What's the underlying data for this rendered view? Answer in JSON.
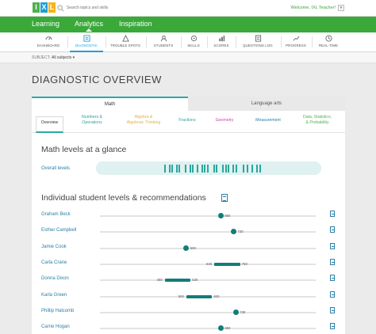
{
  "brand": {
    "logo_letters": [
      "I",
      "X",
      "L"
    ],
    "colors": {
      "green": "#3aa93a",
      "blue": "#1f9ed8",
      "teal": "#127d79",
      "yellow": "#f4b41a"
    }
  },
  "header": {
    "search_placeholder": "Search topics and skills",
    "welcome": "Welcome, IXL Teacher!",
    "dropdown_symbol": "▾"
  },
  "main_nav": [
    {
      "label": "Learning",
      "active": false
    },
    {
      "label": "Analytics",
      "active": true
    },
    {
      "label": "Inspiration",
      "active": false
    }
  ],
  "analytics_tabs": [
    {
      "label": "DASHBOARD",
      "icon": "gauge-icon",
      "active": false
    },
    {
      "label": "DIAGNOSTIC",
      "icon": "diagnostic-icon",
      "active": true
    },
    {
      "label": "TROUBLE SPOTS",
      "icon": "trouble-spots-icon",
      "active": false
    },
    {
      "label": "STUDENTS",
      "icon": "students-icon",
      "active": false
    },
    {
      "label": "SKILLS",
      "icon": "skills-icon",
      "active": false
    },
    {
      "label": "SCORES",
      "icon": "scores-icon",
      "active": false
    },
    {
      "label": "QUESTIONS LOG",
      "icon": "questions-log-icon",
      "active": false
    },
    {
      "label": "PROGRESS",
      "icon": "progress-icon",
      "active": false
    },
    {
      "label": "REAL-TIME",
      "icon": "real-time-icon",
      "active": false
    }
  ],
  "subject_filter": {
    "label": "SUBJECT:",
    "value": "All subjects ▾"
  },
  "page_title": "DIAGNOSTIC OVERVIEW",
  "subject_tabs": [
    {
      "label": "Math",
      "active": true
    },
    {
      "label": "Language arts",
      "active": false
    }
  ],
  "strand_tabs": [
    {
      "lines": [
        "Overview"
      ],
      "color": "#333333",
      "active": true
    },
    {
      "lines": [
        "Numbers &",
        "Operations"
      ],
      "color": "#2aa6a0",
      "active": false
    },
    {
      "lines": [
        "Algebra &",
        "Algebraic Thinking"
      ],
      "color": "#e3b23c",
      "active": false
    },
    {
      "lines": [
        "Fractions"
      ],
      "color": "#2aa6a0",
      "active": false
    },
    {
      "lines": [
        "Geometry"
      ],
      "color": "#d23fa3",
      "active": false
    },
    {
      "lines": [
        "Measurement"
      ],
      "color": "#2a7fa8",
      "active": false
    },
    {
      "lines": [
        "Data, Statistics,",
        "& Probability"
      ],
      "color": "#4cb24f",
      "active": false
    }
  ],
  "glance": {
    "heading": "Math levels at a glance",
    "overall_label": "Overall levels",
    "tick_count": 24
  },
  "individual": {
    "heading": "Individual student levels & recommendations",
    "students": [
      {
        "name": "Graham Beck",
        "level": 660
      },
      {
        "name": "Esther Campbell",
        "level": 720
      },
      {
        "name": "Jamie Cook",
        "level": 500
      },
      {
        "name": "Carla Crane",
        "range": [
          630,
          750
        ],
        "labels": [
          "630",
          "750"
        ]
      },
      {
        "name": "Donna Dixon",
        "range": [
          400,
          520
        ],
        "labels": [
          "400",
          "520"
        ]
      },
      {
        "name": "Karla Green",
        "range": [
          500,
          620
        ],
        "labels": [
          "500",
          "620"
        ]
      },
      {
        "name": "Phillip Halcomb",
        "level": 730
      },
      {
        "name": "Carrie Hogan",
        "level": 660
      }
    ]
  }
}
